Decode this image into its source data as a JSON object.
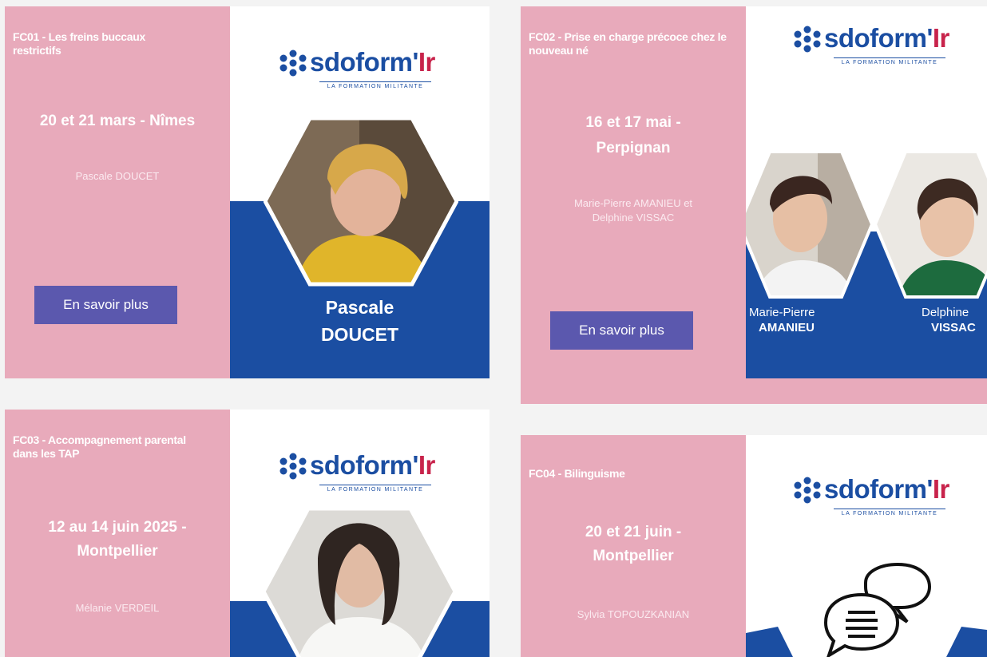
{
  "logo": {
    "name": "sdoform'",
    "name_accent": "Ir",
    "tagline": "LA FORMATION MILITANTE"
  },
  "cards": [
    {
      "code": "FC01 - Les freins buccaux restrictifs",
      "date_line1": "20 et 21 mars - Nîmes",
      "date_line2": "",
      "trainer": "Pascale DOUCET",
      "button": "En savoir plus",
      "portrait_first": "Pascale",
      "portrait_last": "DOUCET"
    },
    {
      "code": "FC02 - Prise en charge précoce chez le nouveau né",
      "date_line1": "16 et 17 mai -",
      "date_line2": "Perpignan",
      "trainer_line1": "Marie-Pierre AMANIEU et",
      "trainer_line2": "Delphine VISSAC",
      "button": "En savoir plus",
      "person1_first": "Marie-Pierre",
      "person1_last": "AMANIEU",
      "person2_first": "Delphine",
      "person2_last": "VISSAC"
    },
    {
      "code": "FC03 - Accompagnement parental dans les TAP",
      "date_line1": "12 au 14 juin 2025 -",
      "date_line2": "Montpellier",
      "trainer": "Mélanie VERDEIL"
    },
    {
      "code": "FC04 - Bilinguisme",
      "date_line1": "20 et 21 juin -",
      "date_line2": "Montpellier",
      "trainer": "Sylvia TOPOUZKANIAN"
    }
  ],
  "colors": {
    "pink": "#e8aabb",
    "blue": "#1b4ea2",
    "button": "#5b58ae",
    "accent_red": "#c8234b"
  }
}
